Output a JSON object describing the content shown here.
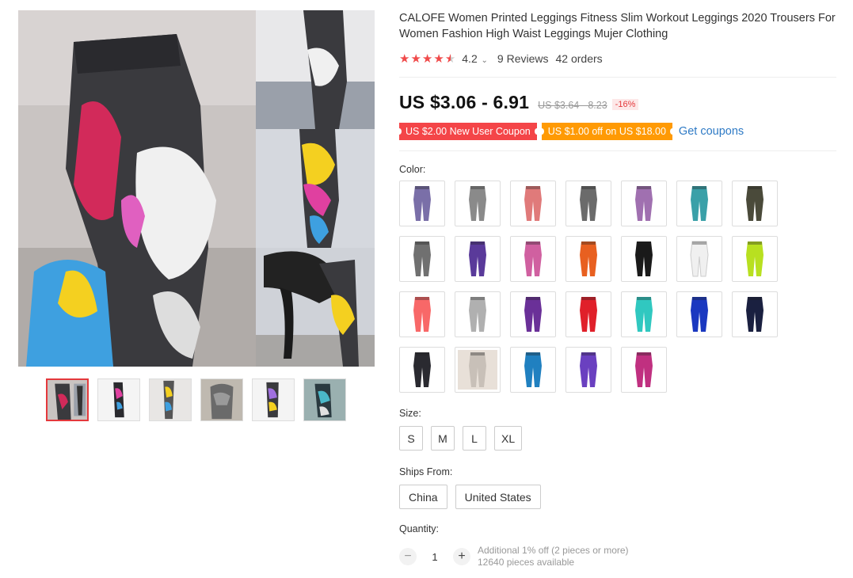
{
  "product": {
    "title": "CALOFE Women Printed Leggings Fitness Slim Workout Leggings 2020 Trousers For Women Fashion High Waist Leggings Mujer Clothing",
    "rating": "4.2",
    "reviews": "9 Reviews",
    "orders": "42 orders"
  },
  "price": {
    "current": "US $3.06 - 6.91",
    "original": "US $3.64 - 8.23",
    "discount": "-16%"
  },
  "coupons": {
    "new_user": "US $2.00 New User Coupon",
    "store": "US $1.00 off on US $18.00",
    "get": "Get coupons"
  },
  "color": {
    "label": "Color:",
    "swatch_colors": [
      "#7a6fa8",
      "#8a8a8a",
      "#e07a7a",
      "#6b6b6b",
      "#a070b0",
      "#3aa0a8",
      "#4a4a3a",
      "#707070",
      "#5a3a9a",
      "#d060a0",
      "#e86020",
      "#1a1a1a",
      "#f0f0f0",
      "#b8e020",
      "#f86868",
      "#b0b0b0",
      "#6a3098",
      "#e0202a",
      "#30c8c0",
      "#1a38c0",
      "#1a2040",
      "#2a2a30",
      "#c8c0b8",
      "#2080c0",
      "#6a40c0",
      "#c03080"
    ]
  },
  "size": {
    "label": "Size:",
    "options": [
      "S",
      "M",
      "L",
      "XL"
    ]
  },
  "ships": {
    "label": "Ships From:",
    "options": [
      "China",
      "United States"
    ]
  },
  "quantity": {
    "label": "Quantity:",
    "value": "1",
    "minus": "−",
    "plus": "+",
    "note_line1": "Additional 1% off (2 pieces or more)",
    "note_line2": "12640 pieces available"
  }
}
